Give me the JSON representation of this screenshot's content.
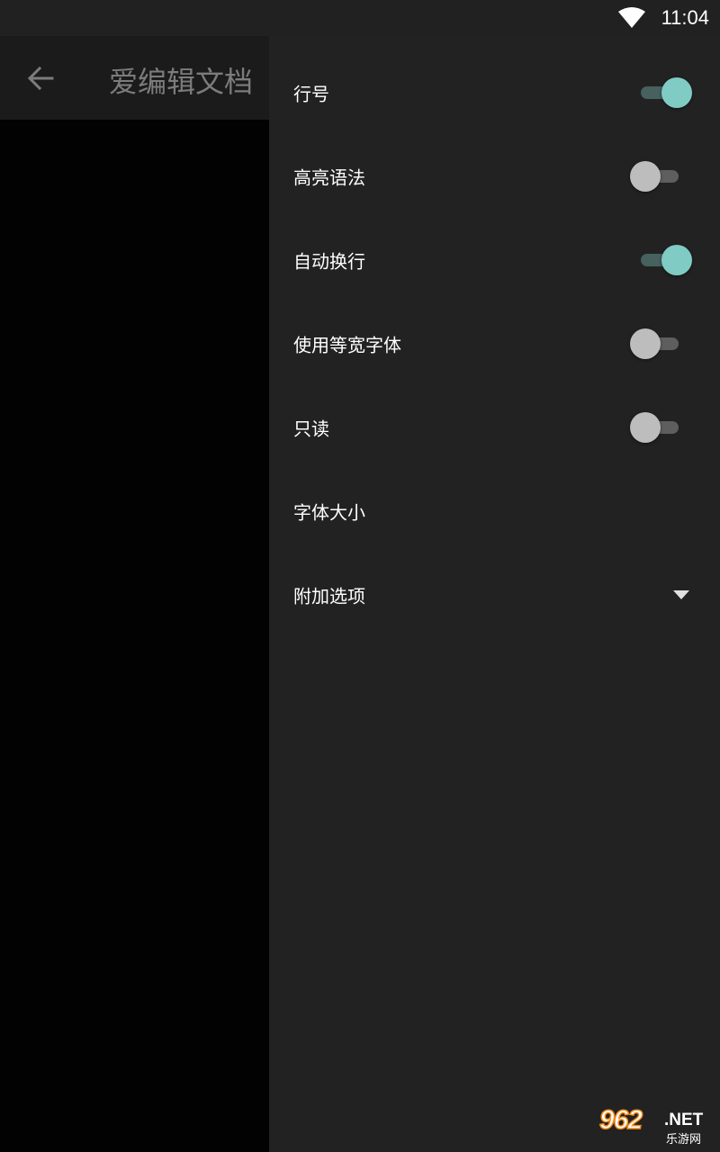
{
  "status_bar": {
    "time": "11:04",
    "wifi_icon": "wifi-icon"
  },
  "app_bar": {
    "back_icon": "arrow-back-icon",
    "title": "爱编辑文档"
  },
  "drawer": {
    "settings": [
      {
        "label": "行号",
        "type": "switch",
        "checked": true
      },
      {
        "label": "高亮语法",
        "type": "switch",
        "checked": false
      },
      {
        "label": "自动换行",
        "type": "switch",
        "checked": true
      },
      {
        "label": "使用等宽字体",
        "type": "switch",
        "checked": false
      },
      {
        "label": "只读",
        "type": "switch",
        "checked": false
      },
      {
        "label": "字体大小",
        "type": "item"
      },
      {
        "label": "附加选项",
        "type": "expandable",
        "icon": "triangle-down-icon"
      }
    ]
  },
  "watermark": {
    "number": "962",
    "domain": ".NET",
    "subtitle": "乐游网"
  },
  "colors": {
    "accent": "#80cbc4",
    "drawer_bg": "#222222",
    "status_bar_bg": "#212121"
  }
}
